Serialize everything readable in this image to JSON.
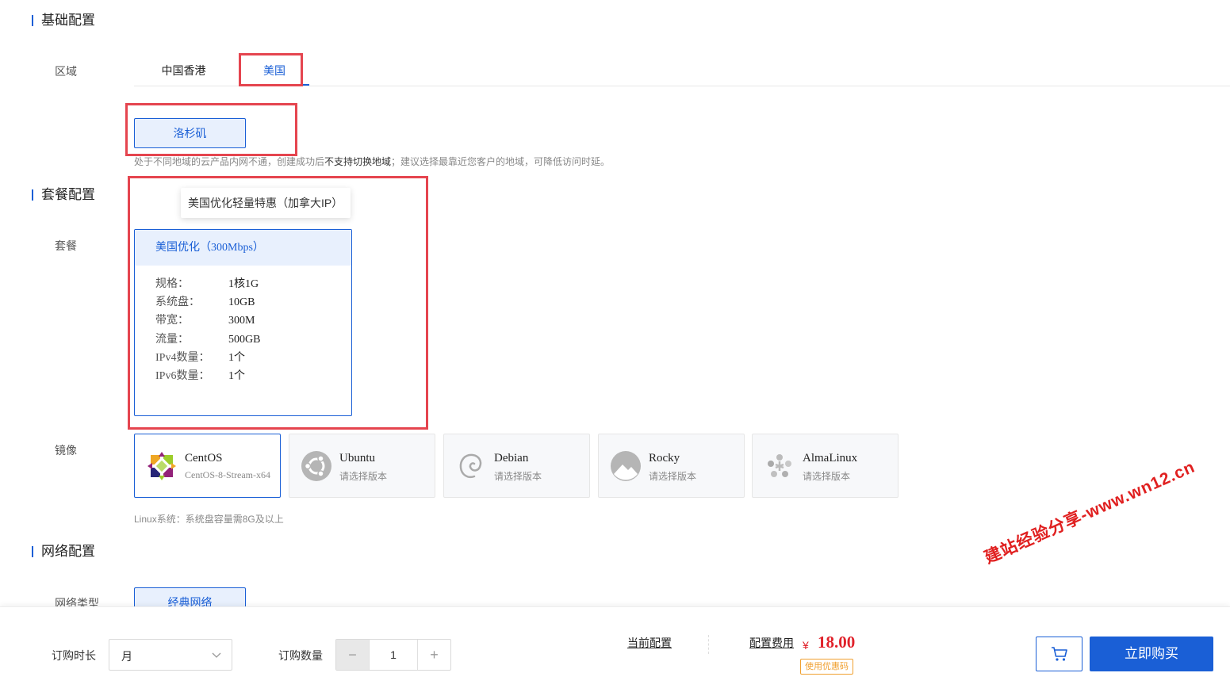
{
  "sections": {
    "basic": "基础配置",
    "package": "套餐配置",
    "network": "网络配置"
  },
  "region": {
    "label": "区域",
    "tabs": [
      {
        "label": "中国香港",
        "active": false
      },
      {
        "label": "美国",
        "active": true
      }
    ],
    "city": "洛杉矶",
    "note_prefix": "处于不同地域的云产品内网不通，创建成功后",
    "note_bold": "不支持切换地域",
    "note_suffix": "；建议选择最靠近您客户的地域，可降低访问时延。"
  },
  "package": {
    "label": "套餐",
    "tooltip": "美国优化轻量特惠（加拿大IP）",
    "card": {
      "title": "美国优化（300Mbps）",
      "specs": [
        {
          "k": "规格：",
          "v": "1核1G"
        },
        {
          "k": "系统盘：",
          "v": "10GB"
        },
        {
          "k": "带宽：",
          "v": "300M"
        },
        {
          "k": "流量：",
          "v": "500GB"
        },
        {
          "k": "IPv4数量：",
          "v": "1个"
        },
        {
          "k": "IPv6数量：",
          "v": "1个"
        }
      ]
    }
  },
  "image": {
    "label": "镜像",
    "options": [
      {
        "name": "CentOS",
        "sub": "CentOS-8-Stream-x64",
        "icon": "centos-icon",
        "active": true
      },
      {
        "name": "Ubuntu",
        "sub": "请选择版本",
        "icon": "ubuntu-icon",
        "active": false
      },
      {
        "name": "Debian",
        "sub": "请选择版本",
        "icon": "debian-icon",
        "active": false
      },
      {
        "name": "Rocky",
        "sub": "请选择版本",
        "icon": "rocky-icon",
        "active": false
      },
      {
        "name": "AlmaLinux",
        "sub": "请选择版本",
        "icon": "almalinux-icon",
        "active": false
      }
    ],
    "note": "Linux系统：系统盘容量需8G及以上"
  },
  "network": {
    "label": "网络类型",
    "option": "经典网络"
  },
  "watermark": "建站经验分享-www.wn12.cn",
  "bottom": {
    "duration_label": "订购时长",
    "duration_value": "月",
    "quantity_label": "订购数量",
    "quantity_minus": "−",
    "quantity_value": "1",
    "quantity_plus": "+",
    "current_config": "当前配置",
    "fee_label": "配置费用",
    "currency": "¥",
    "price": "18.00",
    "coupon": "使用优惠码",
    "buy": "立即购买"
  },
  "colors": {
    "primary": "#1a5fd6",
    "price": "#e0222b",
    "highlight_box": "#e5454f",
    "coupon": "#f0a030"
  }
}
